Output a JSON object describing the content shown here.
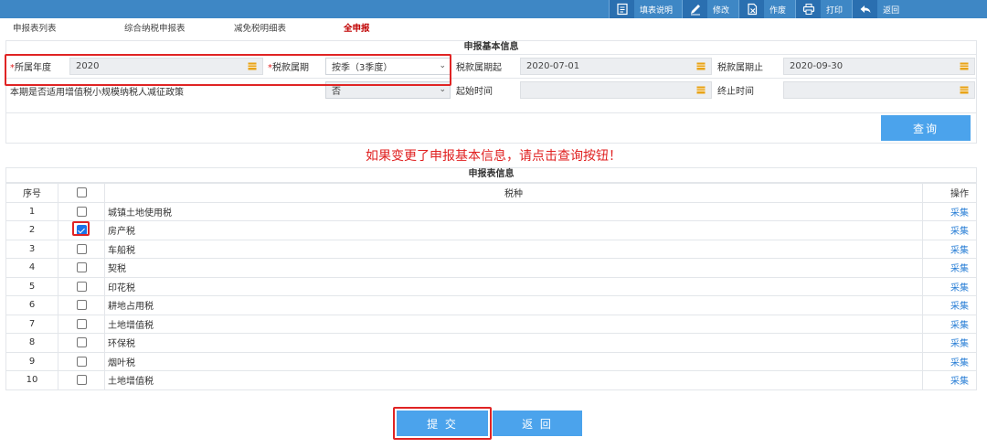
{
  "toolbar": {
    "items": [
      {
        "icon": "document-list-icon",
        "label": "填表说明"
      },
      {
        "icon": "pencil-edit-icon",
        "label": "修改"
      },
      {
        "icon": "void-document-icon",
        "label": "作废"
      },
      {
        "icon": "printer-icon",
        "label": "打印"
      },
      {
        "icon": "back-arrow-icon",
        "label": "返回"
      }
    ]
  },
  "tabs": [
    {
      "label": "申报表列表",
      "active": false
    },
    {
      "label": "综合纳税申报表",
      "active": false
    },
    {
      "label": "减免税明细表",
      "active": false
    },
    {
      "label": "全申报",
      "active": true
    }
  ],
  "basic_info": {
    "title": "申报基本信息",
    "year_label_req": "*",
    "year_label": "所属年度",
    "year_value": "2020",
    "period_label_req": "*",
    "period_label": "税款属期",
    "period_value": "按季（3季度）",
    "start_label": "税款属期起",
    "start_value": "2020-07-01",
    "end_label": "税款属期止",
    "end_value": "2020-09-30",
    "policy_label": "本期是否适用增值税小规模纳税人减征政策",
    "policy_value": "否",
    "begin_time_label": "起始时间",
    "begin_time_value": "",
    "end_time_label": "终止时间",
    "end_time_value": "",
    "query_button": "查询"
  },
  "notice": "如果变更了申报基本信息，请点击查询按钮！",
  "table": {
    "title": "申报表信息",
    "headers": {
      "index": "序号",
      "tax": "税种",
      "action": "操作"
    },
    "rows": [
      {
        "index": "1",
        "tax": "城镇土地使用税",
        "checked": false,
        "action": "采集"
      },
      {
        "index": "2",
        "tax": "房产税",
        "checked": true,
        "action": "采集"
      },
      {
        "index": "3",
        "tax": "车船税",
        "checked": false,
        "action": "采集"
      },
      {
        "index": "4",
        "tax": "契税",
        "checked": false,
        "action": "采集"
      },
      {
        "index": "5",
        "tax": "印花税",
        "checked": false,
        "action": "采集"
      },
      {
        "index": "6",
        "tax": "耕地占用税",
        "checked": false,
        "action": "采集"
      },
      {
        "index": "7",
        "tax": "土地增值税",
        "checked": false,
        "action": "采集"
      },
      {
        "index": "8",
        "tax": "环保税",
        "checked": false,
        "action": "采集"
      },
      {
        "index": "9",
        "tax": "烟叶税",
        "checked": false,
        "action": "采集"
      },
      {
        "index": "10",
        "tax": "土地增值税",
        "checked": false,
        "action": "采集"
      }
    ]
  },
  "footer": {
    "submit_label": "提 交",
    "back_label": "返 回"
  },
  "colors": {
    "toolbar": "#3e87c5",
    "button": "#4ba3ec",
    "highlight": "#e02424",
    "link": "#2a7fd6"
  }
}
